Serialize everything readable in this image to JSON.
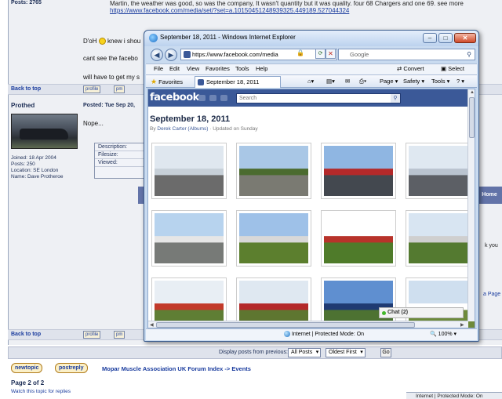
{
  "forum": {
    "posts_top": "Posts: 2765",
    "post_line1": "Martin, the weather was good, so was the company, It wasn't quantity but it was quality. four 68 Chargers and one 69. see more",
    "post_link": "https://www.facebook.com/media/set/?set=a.10150451248939325.449189.527044324",
    "post_doh": "D'oH",
    "post_knew": "knew i shou",
    "post_cant": "cant see the facebo",
    "post_will": "will have to get my s",
    "back_to_top": "Back to top",
    "profile_btn": "profile",
    "pm_btn": "pm",
    "poster_name": "Prothed",
    "posted_label": "Posted: Tue Sep 20,",
    "nope": "Nope...",
    "joined": "Joined: 18 Apr 2004",
    "posts": "Posts: 250",
    "location": "Location: SE London",
    "real_name": "Name: Dave Protheroe",
    "att_description": "Description:",
    "att_filesize": "Filesize:",
    "att_viewed": "Viewed:",
    "home": "Home",
    "frag_you": "k you",
    "frag_page": "a Page",
    "display_label": "Display posts from previous:",
    "display_value": "All Posts",
    "order_value": "Oldest First",
    "go": "Go",
    "newtopic": "newtopic",
    "postreply": "postreply",
    "breadcrumb": "Mopar Muscle Association UK Forum Index -> Events",
    "page_of": "Page 2 of 2",
    "watch": "Watch this topic for replies",
    "status_right": "Internet | Protected Mode: On"
  },
  "ie": {
    "title": "September 18, 2011 - Windows Internet Explorer",
    "address": "https://www.facebook.com/media",
    "search_placeholder": "Google",
    "menu": [
      "File",
      "Edit",
      "View",
      "Favorites",
      "Tools",
      "Help"
    ],
    "convert": "Convert",
    "select": "Select",
    "favorites": "Favorites",
    "tab_title": "September 18, 2011",
    "page_cmd": "Page",
    "safety_cmd": "Safety",
    "tools_cmd": "Tools",
    "help_cmd": "?",
    "status_zone": "Internet | Protected Mode: On",
    "zoom": "100%"
  },
  "fb": {
    "logo": "facebook",
    "search_placeholder": "Search",
    "album_title": "September 18, 2011",
    "by": "By",
    "author": "Derek Carter (Albums)",
    "updated": "· Updated on Sunday",
    "chat": "Chat (2)"
  },
  "thumbs": [
    {
      "sky": "#dfe7ef",
      "ground": "#6b6b6b",
      "accent": "#c7d0d8"
    },
    {
      "sky": "#a9c7e6",
      "ground": "#7a7a72",
      "accent": "#4b6b2f"
    },
    {
      "sky": "#8fb6e2",
      "ground": "#43484f",
      "accent": "#b4292a"
    },
    {
      "sky": "#dfe8f1",
      "ground": "#5c5f65",
      "accent": "#b9c3cf"
    },
    {
      "sky": "#b7d3ee",
      "ground": "#777a77",
      "accent": "#e6e6e6"
    },
    {
      "sky": "#9ec1e8",
      "ground": "#5c7f2e",
      "accent": "#d8d8d8"
    },
    {
      "sky": "#ffffff",
      "ground": "#4f7b2a",
      "accent": "#b8332a"
    },
    {
      "sky": "#d8e5f2",
      "ground": "#547a30",
      "accent": "#cfcfcf"
    },
    {
      "sky": "#e8eef4",
      "ground": "#5f7e34",
      "accent": "#c23a2a"
    },
    {
      "sky": "#dfe8f1",
      "ground": "#5e7630",
      "accent": "#b4292a"
    },
    {
      "sky": "#5f8fd0",
      "ground": "#4d7232",
      "accent": "#1f3a72"
    },
    {
      "sky": "#cfdfef",
      "ground": "#6e8a3a",
      "accent": "#ffffff"
    }
  ]
}
